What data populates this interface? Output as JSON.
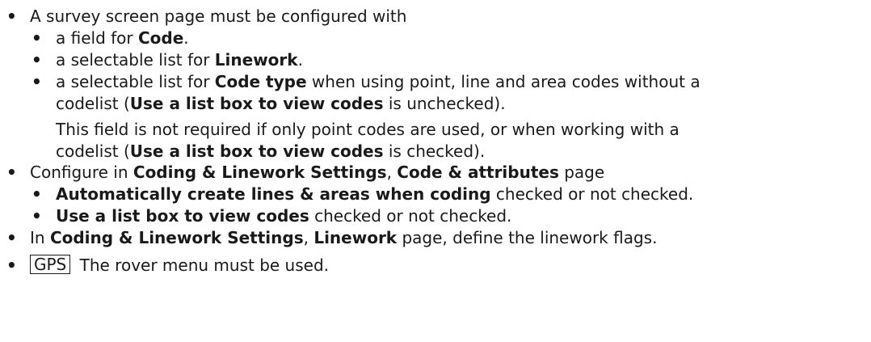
{
  "bullet_glyph": "•",
  "items": {
    "survey": {
      "text": "A survey screen page must be configured with",
      "sub": {
        "code": {
          "pre": "a field for ",
          "bold": "Code",
          "post": "."
        },
        "linework": {
          "pre": "a selectable list for ",
          "bold": "Linework",
          "post": "."
        },
        "code_type": {
          "pre": "a selectable list for ",
          "bold": "Code type",
          "post": " when using point, line and area codes without a",
          "line2_pre": "codelist (",
          "line2_bold": "Use a list box to view codes",
          "line2_post": " is unchecked)."
        },
        "note": {
          "line1": "This field is not required if only point codes are used, or when working with a",
          "line2_pre": "codelist (",
          "line2_bold": "Use a list box to view codes",
          "line2_post": " is checked)."
        }
      }
    },
    "configure": {
      "pre": "Configure in ",
      "bold1": "Coding & Linework Settings",
      "mid": ", ",
      "bold2": "Code & attributes",
      "post": " page",
      "sub": {
        "auto": {
          "bold": "Automatically create lines & areas when coding",
          "post": " checked or not checked."
        },
        "listbox": {
          "bold": "Use a list box to view codes",
          "post": " checked or not checked."
        }
      }
    },
    "linework_flags": {
      "pre": "In ",
      "bold1": "Coding & Linework Settings",
      "mid": ", ",
      "bold2": "Linework",
      "post": " page, define the linework flags."
    },
    "gps": {
      "tag": "GPS",
      "text": " The rover menu must be used."
    }
  }
}
